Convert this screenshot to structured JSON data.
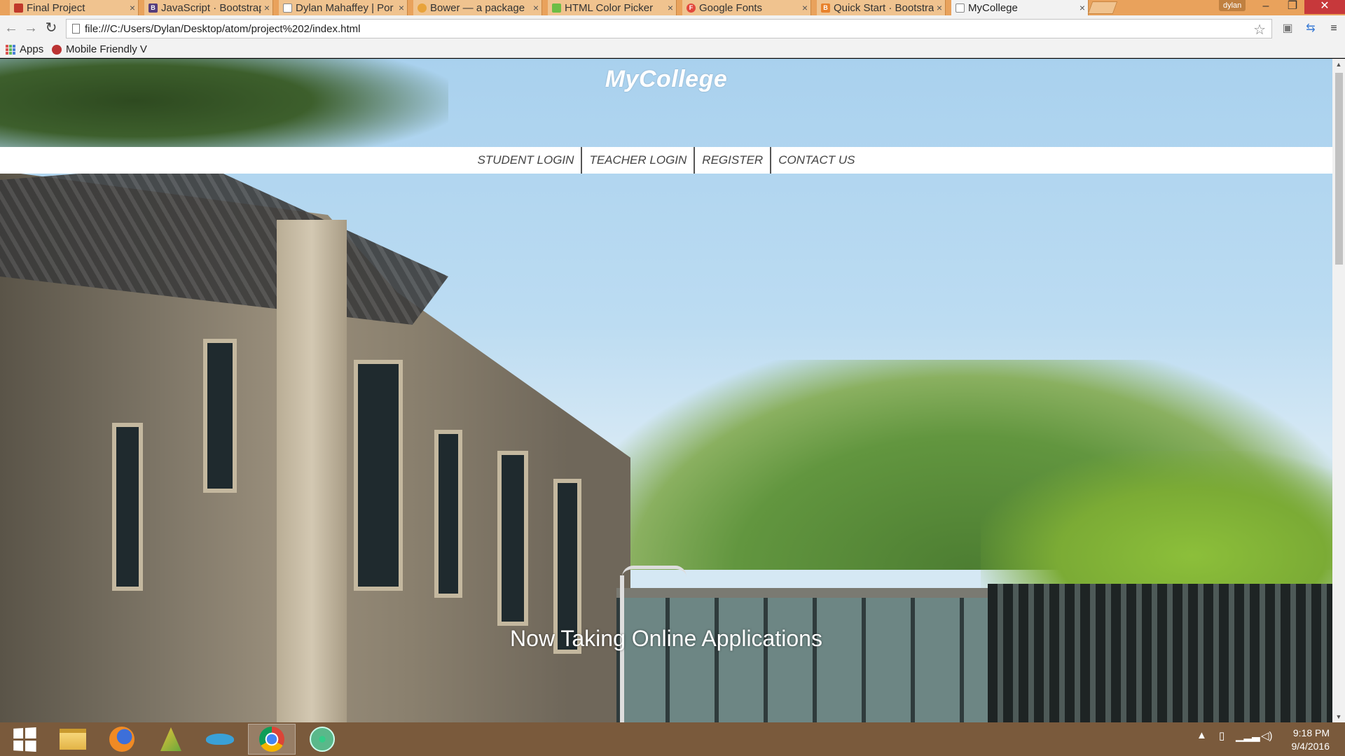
{
  "browser": {
    "tabs": [
      {
        "title": "Final Project",
        "favicon_color": "#c0392b",
        "active": false
      },
      {
        "title": "JavaScript · Bootstrap",
        "favicon_color": "#563d7c",
        "favicon_letter": "B",
        "active": false
      },
      {
        "title": "Dylan Mahaffey | Por",
        "favicon_color": "#888888",
        "active": false
      },
      {
        "title": "Bower — a package",
        "favicon_color": "#e8a33b",
        "active": false
      },
      {
        "title": "HTML Color Picker",
        "favicon_color": "#6dbd45",
        "active": false
      },
      {
        "title": "Google Fonts",
        "favicon_color": "#e2483d",
        "favicon_letter": "F",
        "active": false
      },
      {
        "title": "Quick Start · Bootstra",
        "favicon_color": "#e8822c",
        "favicon_letter": "B",
        "active": false
      },
      {
        "title": "MyCollege",
        "favicon_color": "#888888",
        "active": true
      }
    ],
    "profile": "dylan",
    "url": "file:///C:/Users/Dylan/Desktop/atom/project%202/index.html",
    "bookmarks": [
      {
        "label": "Apps",
        "icon": "apps-grid-icon"
      },
      {
        "label": "Mobile Friendly V",
        "icon": "bookmark-favicon"
      }
    ],
    "accent": "#e9a25c"
  },
  "page": {
    "title": "MyCollege",
    "nav": [
      "STUDENT LOGIN",
      "TEACHER LOGIN",
      "REGISTER",
      "CONTACT US"
    ],
    "headline": "Now Taking Online Applications"
  },
  "taskbar": {
    "apps": [
      "start-icon",
      "file-explorer-icon",
      "firefox-icon",
      "app-icon",
      "dolphin-icon",
      "chrome-icon",
      "atom-icon"
    ],
    "active_app": "chrome-icon",
    "time": "9:18 PM",
    "date": "9/4/2016",
    "color": "#7a5a3c"
  }
}
